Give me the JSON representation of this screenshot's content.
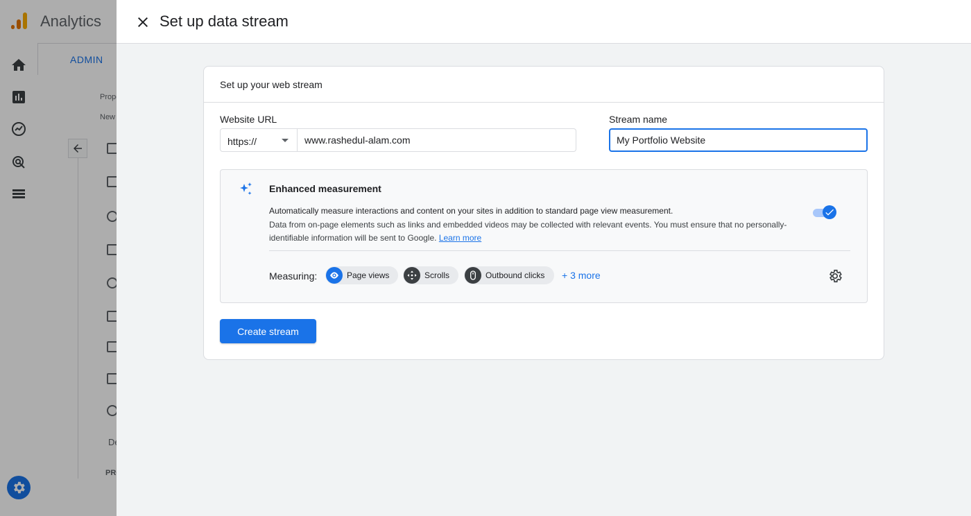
{
  "app": {
    "title": "Analytics"
  },
  "background": {
    "admin_tab_label": "ADMIN",
    "panel_texts": [
      "Prope",
      "New",
      "De",
      "PRO"
    ]
  },
  "drawer": {
    "title": "Set up data stream",
    "close_icon": "close-icon"
  },
  "card": {
    "title": "Set up your web stream",
    "website_url": {
      "label": "Website URL",
      "protocol_selected": "https://",
      "value": "www.rashedul-alam.com"
    },
    "stream_name": {
      "label": "Stream name",
      "value": "My Portfolio Website"
    },
    "enhanced_measurement": {
      "title": "Enhanced measurement",
      "description_line1": "Automatically measure interactions and content on your sites in addition to standard page view measurement.",
      "description_line2": "Data from on-page elements such as links and embedded videos may be collected with relevant events. You must ensure that no personally-identifiable information will be sent to Google.",
      "learn_more": "Learn more",
      "enabled": true,
      "measuring_label": "Measuring:",
      "chips": [
        {
          "label": "Page views",
          "icon": "eye-icon",
          "color": "#1a73e8"
        },
        {
          "label": "Scrolls",
          "icon": "scroll-icon",
          "color": "#3c4043"
        },
        {
          "label": "Outbound clicks",
          "icon": "mouse-icon",
          "color": "#3c4043"
        }
      ],
      "more_link": "+ 3 more"
    },
    "create_button": "Create stream"
  },
  "colors": {
    "accent": "#1a73e8",
    "text": "#202124",
    "border": "#dadce0"
  }
}
